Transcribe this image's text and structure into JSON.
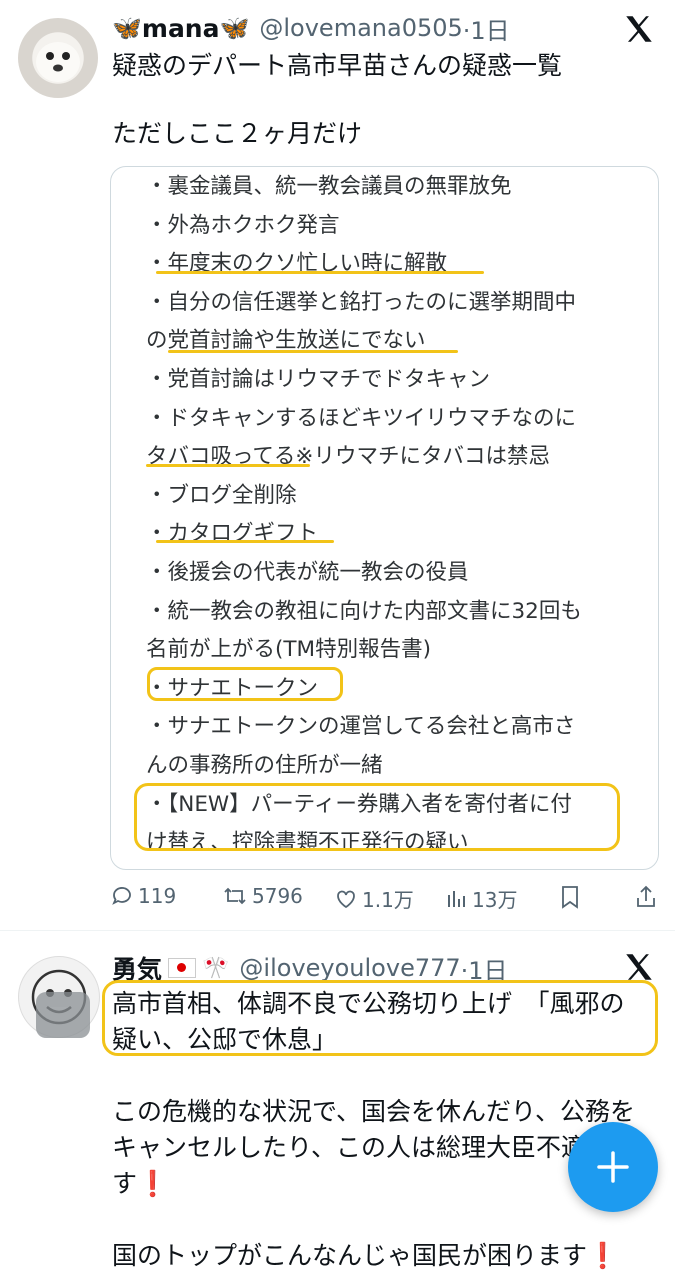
{
  "tweet1": {
    "display_name": "mana",
    "handle": "@lovemana0505",
    "time": "·1日",
    "title": "疑惑のデパート高市早苗さんの疑惑一覧",
    "subtitle": "ただしここ２ヶ月だけ",
    "card_lines": [
      "・裏金議員、統一教会議員の無罪放免",
      "・外為ホクホク発言",
      "・年度末のクソ忙しい時に解散",
      "・自分の信任選挙と銘打ったのに選挙期間中",
      "の党首討論や生放送にでない",
      "・党首討論はリウマチでドタキャン",
      "・ドタキャンするほどキツイリウマチなのに",
      "タバコ吸ってる※リウマチにタバコは禁忌",
      "・ブログ全削除",
      "・カタログギフト",
      "・後援会の代表が統一教会の役員",
      "・統一教会の教祖に向けた内部文書に32回も",
      "名前が上がる(TM特別報告書)",
      "・サナエトークン",
      "・サナエトークンの運営してる会社と高市さ",
      "んの事務所の住所が一緒",
      "・【NEW】パーティー券購入者を寄付者に付",
      "け替え、控除書類不正発行の疑い"
    ],
    "actions": {
      "replies": "119",
      "retweets": "5796",
      "likes": "1.1万",
      "views": "13万"
    }
  },
  "tweet2": {
    "display_name": "勇気",
    "handle": "@iloveyoulove777",
    "time": "·1日",
    "lines": [
      "高市首相、体調不良で公務切り上げ　「風邪の",
      "疑い、公邸で休息」",
      "",
      "この危機的な状況で、国会を休んだり、公務を",
      "キャンセルしたり、この人は総理大臣不適",
      "す❗️",
      "",
      "国のトップがこんなんじゃ国民が困ります❗️"
    ]
  },
  "colors": {
    "highlight": "#f2c318",
    "accent": "#1d9bf0",
    "secondary_text": "#536471"
  }
}
